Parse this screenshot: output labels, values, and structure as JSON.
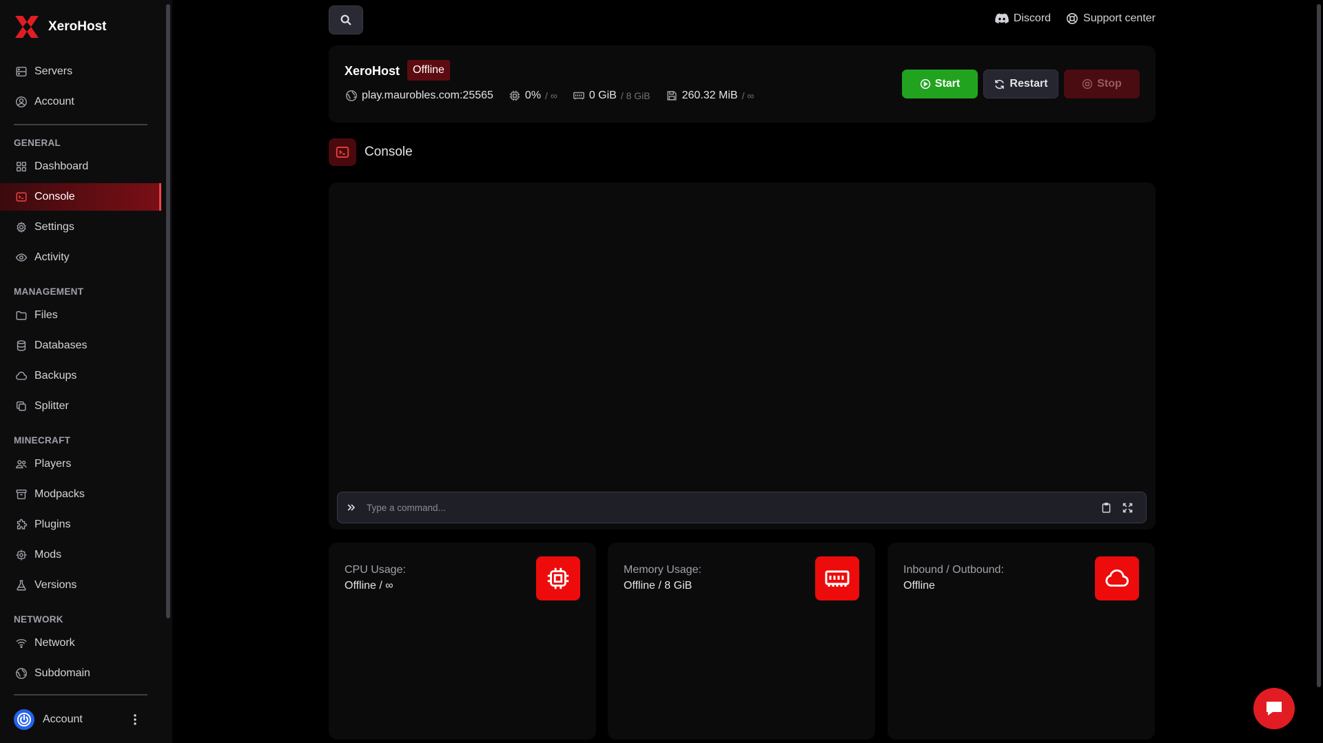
{
  "brand": {
    "name": "XeroHost",
    "accent": "#ef4444"
  },
  "sidebar": {
    "top": [
      {
        "label": "Servers",
        "icon": "server-icon"
      },
      {
        "label": "Account",
        "icon": "user-circle-icon"
      }
    ],
    "sections": [
      {
        "title": "GENERAL",
        "items": [
          "Dashboard",
          "Console",
          "Settings",
          "Activity"
        ]
      },
      {
        "title": "MANAGEMENT",
        "items": [
          "Files",
          "Databases",
          "Backups",
          "Splitter"
        ]
      },
      {
        "title": "MINECRAFT",
        "items": [
          "Players",
          "Modpacks",
          "Plugins",
          "Mods",
          "Versions"
        ]
      },
      {
        "title": "NETWORK",
        "items": [
          "Network",
          "Subdomain"
        ]
      }
    ],
    "active": "Console",
    "account_label": "Account"
  },
  "topbar": {
    "discord": "Discord",
    "support": "Support center"
  },
  "server": {
    "name": "XeroHost",
    "status": "Offline",
    "address": "play.maurobles.com:25565",
    "cpu": "0%",
    "cpu_limit": "/ ∞",
    "memory": "0 GiB",
    "memory_limit": "/ 8 GiB",
    "disk": "260.32 MiB",
    "disk_limit": "/ ∞",
    "buttons": {
      "start": "Start",
      "restart": "Restart",
      "stop": "Stop"
    }
  },
  "console": {
    "title": "Console",
    "placeholder": "Type a command..."
  },
  "metrics": {
    "cpu": {
      "label": "CPU Usage:",
      "value": "Offline / ∞"
    },
    "memory": {
      "label": "Memory Usage:",
      "value": "Offline / 8 GiB"
    },
    "network": {
      "label": "Inbound / Outbound:",
      "value": "Offline"
    }
  }
}
